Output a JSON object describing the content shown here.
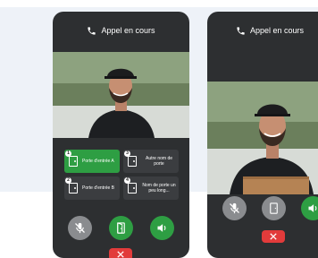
{
  "status_title": "Appel en cours",
  "doors": [
    {
      "number": "1",
      "label": "Porte d'entrée A",
      "active": true
    },
    {
      "number": "3",
      "label": "Autre nom de porte",
      "active": false
    },
    {
      "number": "2",
      "label": "Porte d'entrée B",
      "active": false
    },
    {
      "number": "4",
      "label": "Nom de porte un peu long...",
      "active": false
    }
  ],
  "icons": {
    "call": "phone-icon",
    "mute": "microphone-muted-icon",
    "door": "door-open-icon",
    "speaker": "speaker-icon",
    "hangup": "close-icon"
  },
  "colors": {
    "phone_bg": "#2d2f31",
    "active_green": "#2e9e43",
    "mute_grey": "#8a8c8f",
    "hangup_red": "#e23b3b",
    "backdrop": "#eef2f8"
  }
}
